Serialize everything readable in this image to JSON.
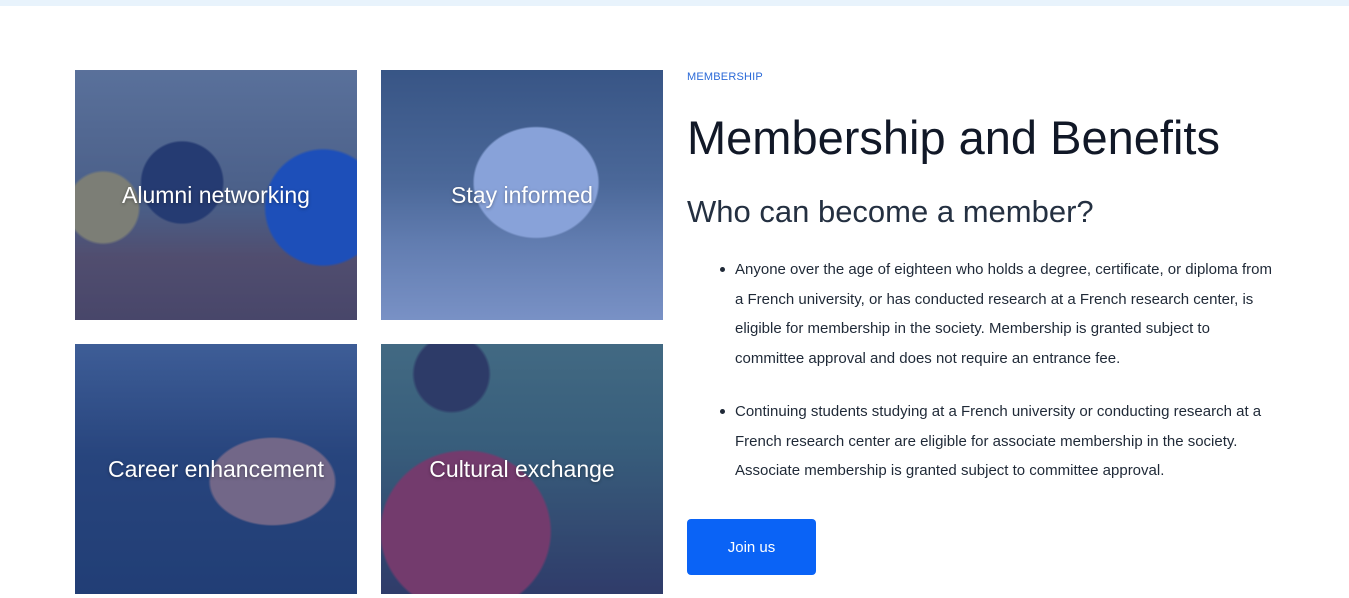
{
  "tiles": [
    {
      "label": "Alumni networking"
    },
    {
      "label": "Stay informed"
    },
    {
      "label": "Career enhancement"
    },
    {
      "label": "Cultural exchange"
    }
  ],
  "section": {
    "eyebrow": "MEMBERSHIP",
    "title": "Membership and Benefits",
    "subtitle": "Who can become a member?",
    "bullets": [
      "Anyone over the age of eighteen who holds a degree, certificate, or diploma from a French university, or has conducted research at a French research center, is eligible for membership in the society. Membership is granted subject to committee approval and does not require an entrance fee.",
      "Continuing students studying at a French university or conducting research at a French research center are eligible for associate membership in the society. Associate membership is granted subject to committee approval."
    ],
    "join_label": "Join us"
  },
  "colors": {
    "accent": "#0a63f6",
    "eyebrow": "#2b6ad8",
    "tile_overlay": "#1e50be",
    "top_strip": "#e8f3fc"
  }
}
